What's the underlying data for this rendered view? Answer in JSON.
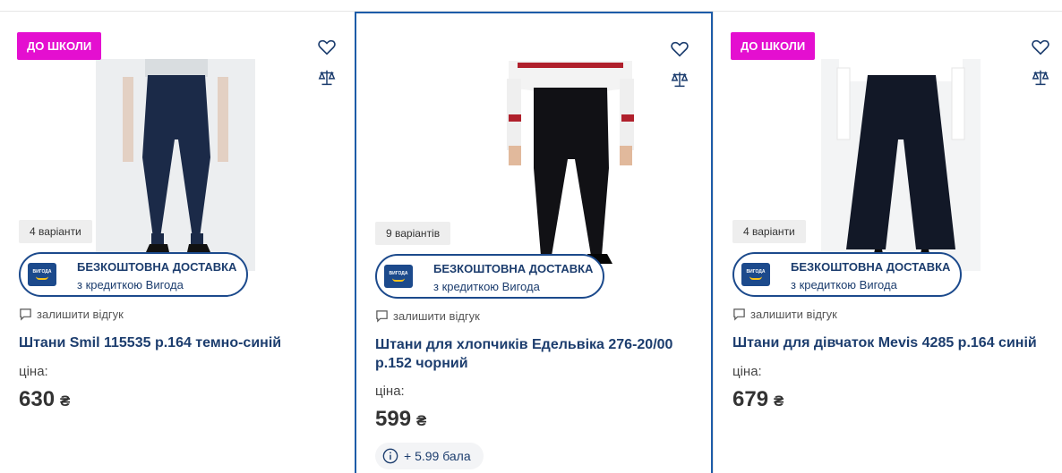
{
  "products": [
    {
      "badge": "до школи",
      "variants": "4 варіанти",
      "delivery": {
        "title": "БЕЗКОШТОВНА ДОСТАВКА",
        "subtitle": "з кредиткою Вигода",
        "logo_text": "ВИГОДА"
      },
      "review": "залишити відгук",
      "title": "Штани Smil 115535 р.164 темно-синій",
      "price_label": "ціна:",
      "price": "630",
      "currency": "₴"
    },
    {
      "variants": "9 варіантів",
      "delivery": {
        "title": "БЕЗКОШТОВНА ДОСТАВКА",
        "subtitle": "з кредиткою Вигода",
        "logo_text": "ВИГОДА"
      },
      "review": "залишити відгук",
      "title": "Штани для хлопчиків Едельвіка 276-20/00 р.152 чорний",
      "price_label": "ціна:",
      "price": "599",
      "currency": "₴",
      "bonus": "+ 5.99 бала"
    },
    {
      "badge": "до школи",
      "variants": "4 варіанти",
      "delivery": {
        "title": "БЕЗКОШТОВНА ДОСТАВКА",
        "subtitle": "з кредиткою Вигода",
        "logo_text": "ВИГОДА"
      },
      "review": "залишити відгук",
      "title": "Штани для дівчаток Mevis 4285 р.164 синій",
      "price_label": "ціна:",
      "price": "679",
      "currency": "₴"
    }
  ],
  "colors": {
    "accent": "#1c3d6e",
    "badge": "#e40fd0",
    "active_border": "#1d5ca8"
  }
}
